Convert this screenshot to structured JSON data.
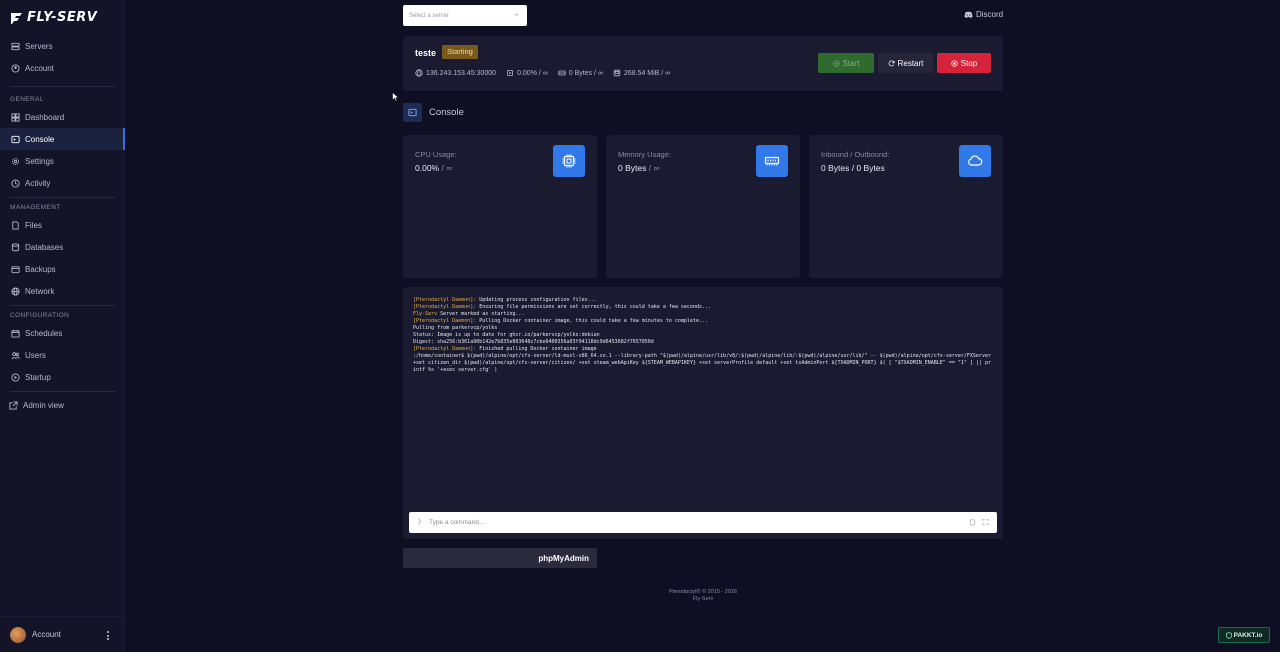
{
  "brand": {
    "name": "FLY-SERV"
  },
  "sidebar": {
    "top_items": [
      {
        "label": "Servers",
        "icon": "server-icon"
      },
      {
        "label": "Account",
        "icon": "user-circle-icon"
      }
    ],
    "sections": {
      "general": "GENERAL",
      "management": "MANAGEMENT",
      "configuration": "CONFIGURATION"
    },
    "general_items": [
      {
        "label": "Dashboard",
        "icon": "dashboard-icon"
      },
      {
        "label": "Console",
        "icon": "terminal-icon",
        "active": true
      },
      {
        "label": "Settings",
        "icon": "gear-icon"
      },
      {
        "label": "Activity",
        "icon": "activity-icon"
      }
    ],
    "management_items": [
      {
        "label": "Files",
        "icon": "file-icon"
      },
      {
        "label": "Databases",
        "icon": "database-icon"
      },
      {
        "label": "Backups",
        "icon": "backup-icon"
      },
      {
        "label": "Network",
        "icon": "network-icon"
      }
    ],
    "configuration_items": [
      {
        "label": "Schedules",
        "icon": "calendar-icon"
      },
      {
        "label": "Users",
        "icon": "users-icon"
      },
      {
        "label": "Startup",
        "icon": "play-icon"
      }
    ],
    "admin_view": "Admin view",
    "bottom_account": "Account"
  },
  "topbar": {
    "server_select_placeholder": "Select a server",
    "discord": "Discord"
  },
  "server": {
    "name": "teste",
    "status": "Starting",
    "address": "136.243.153.45:30000",
    "cpu": "0.00% / ∞",
    "disk": "0 Bytes / ∞",
    "memory": "268.54 MiB / ∞",
    "buttons": {
      "start": "Start",
      "restart": "Restart",
      "stop": "Stop"
    }
  },
  "console_heading": "Console",
  "metrics": [
    {
      "label": "CPU Usage:",
      "value": "0.00%",
      "unit": " / ∞",
      "icon": "cpu-icon"
    },
    {
      "label": "Memory Usage:",
      "value": "0 Bytes",
      "unit": " / ∞",
      "icon": "memory-icon"
    },
    {
      "label": "Inbound / Outbound:",
      "value": "0 Bytes / 0 Bytes",
      "unit": "",
      "icon": "cloud-icon"
    }
  ],
  "terminal": {
    "lines": [
      {
        "tag": "[Pterodactyl Daemon]:",
        "text": " Updating process configuration files..."
      },
      {
        "tag": "[Pterodactyl Daemon]:",
        "text": " Ensuring file permissions are set correctly, this could take a few seconds..."
      },
      {
        "tag": "Fly-Serv",
        "text": " Server marked as starting..."
      },
      {
        "tag": "[Pterodactyl Daemon]:",
        "text": " Pulling Docker container image, this could take a few minutes to complete..."
      },
      {
        "tag": "",
        "text": "Pulling from parkervcp/yolks"
      },
      {
        "tag": "",
        "text": "Status: Image is up to date for ghcr.io/parkervcp/yolks:debian"
      },
      {
        "tag": "",
        "text": "Digest: sha256:b361a90b142e7b835e803648c7cbe6400356a03f94118dc9d6453682f7657050d"
      },
      {
        "tag": "[Pterodactyl Daemon]:",
        "text": " Finished pulling Docker container image"
      },
      {
        "tag": "",
        "text": ":/home/container$ $(pwd)/alpine/opt/cfx-server/ld-musl-x86_64.so.1 --library-path \"$(pwd)/alpine/usr/lib/v8/:$(pwd)/alpine/lib/:$(pwd)/alpine/usr/lib/\" -- $(pwd)/alpine/opt/cfx-server/FXServer +set citizen_dir $(pwd)/alpine/opt/cfx-server/citizen/ +set steam_webApiKey ${STEAM_WEBAPIKEY} +set serverProfile default +set txAdminPort ${TXADMIN_PORT} $( [ \"$TXADMIN_ENABLE\" == \"1\" ] || printf %s '+exec server.cfg' )"
      }
    ],
    "input_placeholder": "Type a command..."
  },
  "phpmyadmin": "phpMyAdmin",
  "footer": {
    "line1": "Pterodactyl® © 2015 - 2026",
    "line2": "Fly-Serv"
  },
  "badge": "PAKKT.io",
  "colors": {
    "accent": "#3178e8",
    "stop": "#d6233a",
    "start": "#2f6a2f",
    "status_starting": "#7a5a1c",
    "terminal_tag": "#e8b040"
  }
}
